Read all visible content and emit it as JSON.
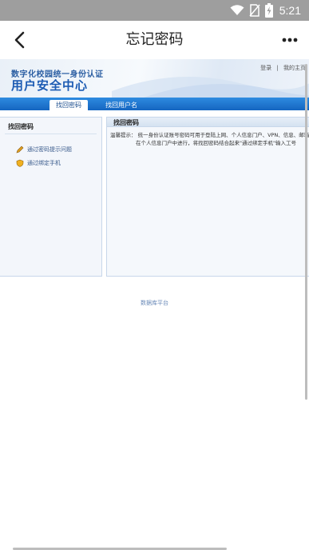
{
  "status_bar": {
    "time": "5:21",
    "icons": [
      "wifi-icon",
      "no-sim-icon",
      "battery-charging-icon"
    ],
    "color": "#9e9e9e"
  },
  "app_bar": {
    "title": "忘记密码",
    "back_icon": "back-arrow-icon",
    "more_icon": "more-dots-icon"
  },
  "web": {
    "banner": {
      "subtitle": "数字化校园统一身份认证",
      "title": "用户安全中心",
      "links": [
        "登录",
        "|",
        "我的主页"
      ]
    },
    "tabs": [
      {
        "label": "找回密码",
        "active": true
      },
      {
        "label": "找回用户名",
        "active": false
      }
    ],
    "left_panel": {
      "heading": "找回密码",
      "items": [
        {
          "label": "通过密码提示问题",
          "icon": "pencil-icon"
        },
        {
          "label": "通过绑定手机",
          "icon": "shield-icon"
        }
      ]
    },
    "right_panel": {
      "heading": "找回密码",
      "line1": "温馨提示：  统一身份认证账号密码可用于登陆上网、个人信息门户、VPN、信息、邮箱等",
      "line2": "在个人信息门户中进行，将找回密码结合起来\"通过绑定手机\"输入工号"
    },
    "footer": "数据库平台"
  },
  "colors": {
    "brand_blue": "#1565c0",
    "title_blue": "#1c5bb3"
  }
}
